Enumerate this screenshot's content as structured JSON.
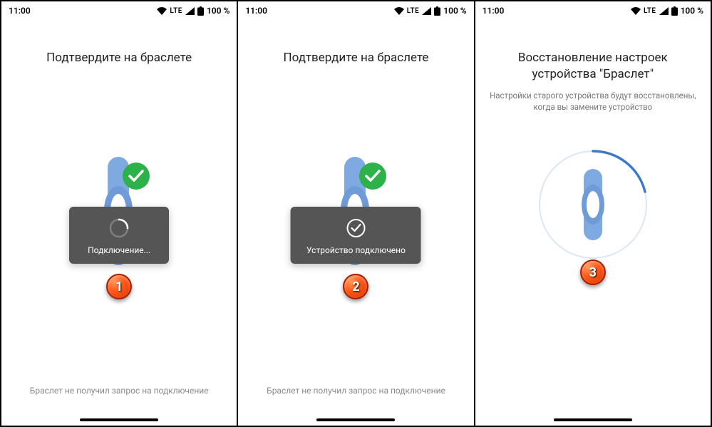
{
  "statusbar": {
    "time": "11:00",
    "lte": "LTE",
    "battery": "100 %"
  },
  "panel1": {
    "title": "Подтвердите на браслете",
    "toast": "Подключение...",
    "step": "1",
    "footer": "Браслет не получил запрос на подключение"
  },
  "panel2": {
    "title": "Подтвердите на браслете",
    "toast": "Устройство подключено",
    "step": "2",
    "footer": "Браслет не получил запрос на подключение"
  },
  "panel3": {
    "title": "Восстановление настроек устройства \"Браслет\"",
    "subtitle": "Настройки старого устройства будут восстановлены, когда вы замените устройство",
    "step": "3"
  }
}
